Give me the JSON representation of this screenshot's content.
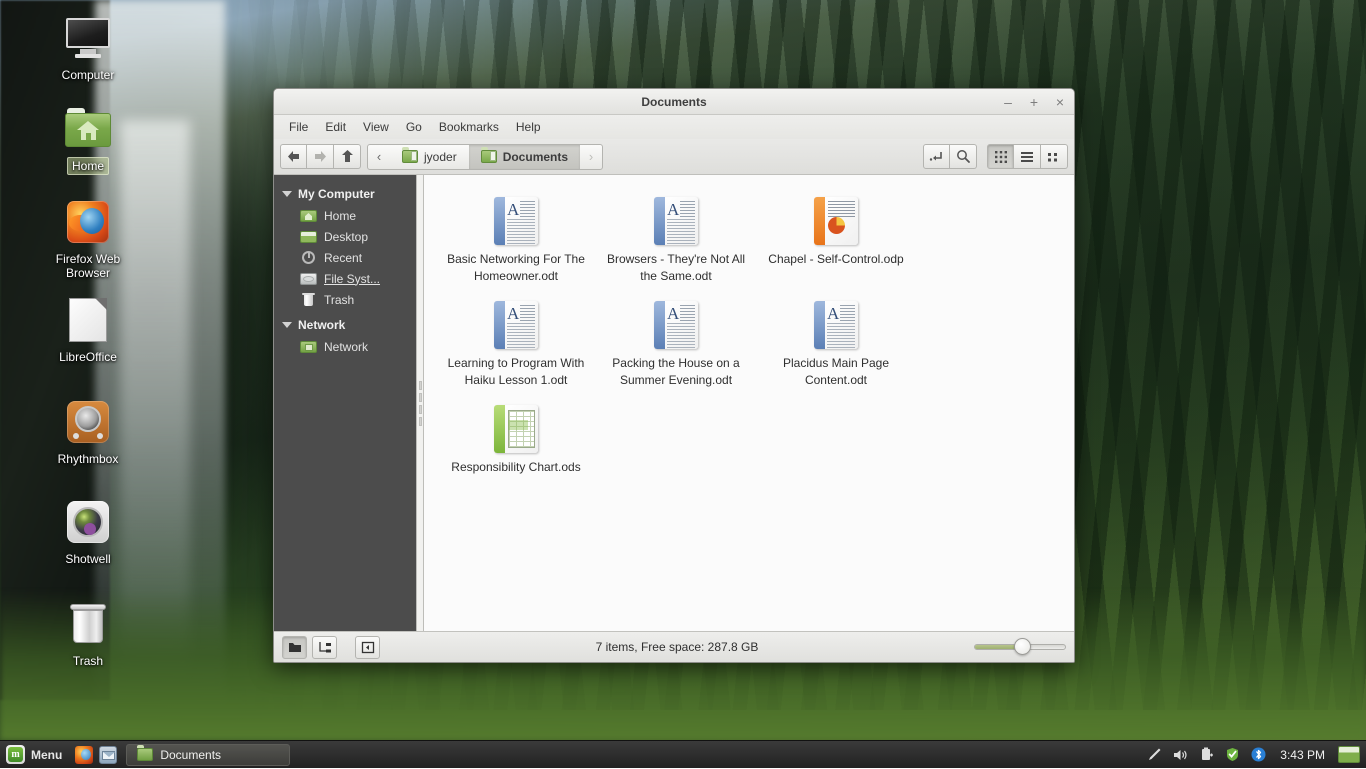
{
  "desktop": {
    "icons": [
      {
        "label": "Computer",
        "icon": "computer-icon",
        "selected": false
      },
      {
        "label": "Home",
        "icon": "home-folder-icon",
        "selected": true
      },
      {
        "label": "Firefox Web Browser",
        "icon": "firefox-icon",
        "selected": false
      },
      {
        "label": "LibreOffice",
        "icon": "libreoffice-icon",
        "selected": false
      },
      {
        "label": "Rhythmbox",
        "icon": "rhythmbox-icon",
        "selected": false
      },
      {
        "label": "Shotwell",
        "icon": "shotwell-icon",
        "selected": false
      },
      {
        "label": "Trash",
        "icon": "trash-icon",
        "selected": false
      }
    ]
  },
  "window": {
    "title": "Documents",
    "controls": {
      "minimize": "–",
      "maximize": "+",
      "close": "×"
    },
    "menubar": [
      "File",
      "Edit",
      "View",
      "Go",
      "Bookmarks",
      "Help"
    ],
    "toolbar": {
      "back_icon": "back-arrow-icon",
      "forward_icon": "forward-arrow-icon",
      "up_icon": "up-arrow-icon",
      "path_entry_icon": "path-entry-icon",
      "search_icon": "search-icon",
      "icon_view_icon": "icon-view-icon",
      "list_view_icon": "list-view-icon",
      "compact_view_icon": "compact-view-icon",
      "active_view": "icon-view"
    },
    "breadcrumb": {
      "prev_arrow": "‹",
      "next_arrow": "›",
      "items": [
        {
          "label": "jyoder",
          "active": false
        },
        {
          "label": "Documents",
          "active": true
        }
      ]
    },
    "sidebar": {
      "groups": [
        {
          "title": "My Computer",
          "items": [
            {
              "label": "Home",
              "icon": "home-icon"
            },
            {
              "label": "Desktop",
              "icon": "desktop-icon"
            },
            {
              "label": "Recent",
              "icon": "recent-icon"
            },
            {
              "label": "File Syst...",
              "icon": "filesystem-icon"
            },
            {
              "label": "Trash",
              "icon": "trash-icon"
            }
          ]
        },
        {
          "title": "Network",
          "items": [
            {
              "label": "Network",
              "icon": "network-icon"
            }
          ]
        }
      ]
    },
    "files": [
      {
        "name": "Basic Networking For The Homeowner.odt",
        "type": "odt"
      },
      {
        "name": "Browsers - They're Not All the Same.odt",
        "type": "odt"
      },
      {
        "name": "Chapel - Self-Control.odp",
        "type": "odp"
      },
      {
        "name": "Learning to Program With Haiku Lesson 1.odt",
        "type": "odt"
      },
      {
        "name": "Packing the House on a Summer Evening.odt",
        "type": "odt"
      },
      {
        "name": "Placidus Main Page Content.odt",
        "type": "odt"
      },
      {
        "name": "Responsibility Chart.ods",
        "type": "ods"
      }
    ],
    "statusbar": {
      "text": "7 items, Free space: 287.8 GB",
      "places_icon": "places-button-icon",
      "tree_icon": "tree-button-icon",
      "sidebar_toggle_icon": "toggle-sidebar-icon",
      "zoom_value": 45
    }
  },
  "taskbar": {
    "menu_label": "Menu",
    "menu_logo": "linux-mint-logo",
    "launchers": [
      {
        "name": "firefox-launcher"
      },
      {
        "name": "thunderbird-launcher"
      }
    ],
    "tasks": [
      {
        "label": "Documents",
        "icon": "folder-icon",
        "active": true
      }
    ],
    "tray": [
      {
        "name": "pen-input-icon",
        "glyph": "✐"
      },
      {
        "name": "volume-icon",
        "glyph": "🔊"
      },
      {
        "name": "battery-icon",
        "glyph": "▮"
      },
      {
        "name": "update-shield-icon",
        "glyph": "✔"
      },
      {
        "name": "bluetooth-icon",
        "glyph": "ᛒ"
      }
    ],
    "clock": "3:43 PM",
    "show_desktop_icon": "show-desktop-icon"
  },
  "colors": {
    "accent_green": "#7aa84a",
    "sidebar_bg": "#4c4c4c",
    "taskbar_bg": "#2a2a2a",
    "bluetooth_blue": "#2a7fd4"
  }
}
